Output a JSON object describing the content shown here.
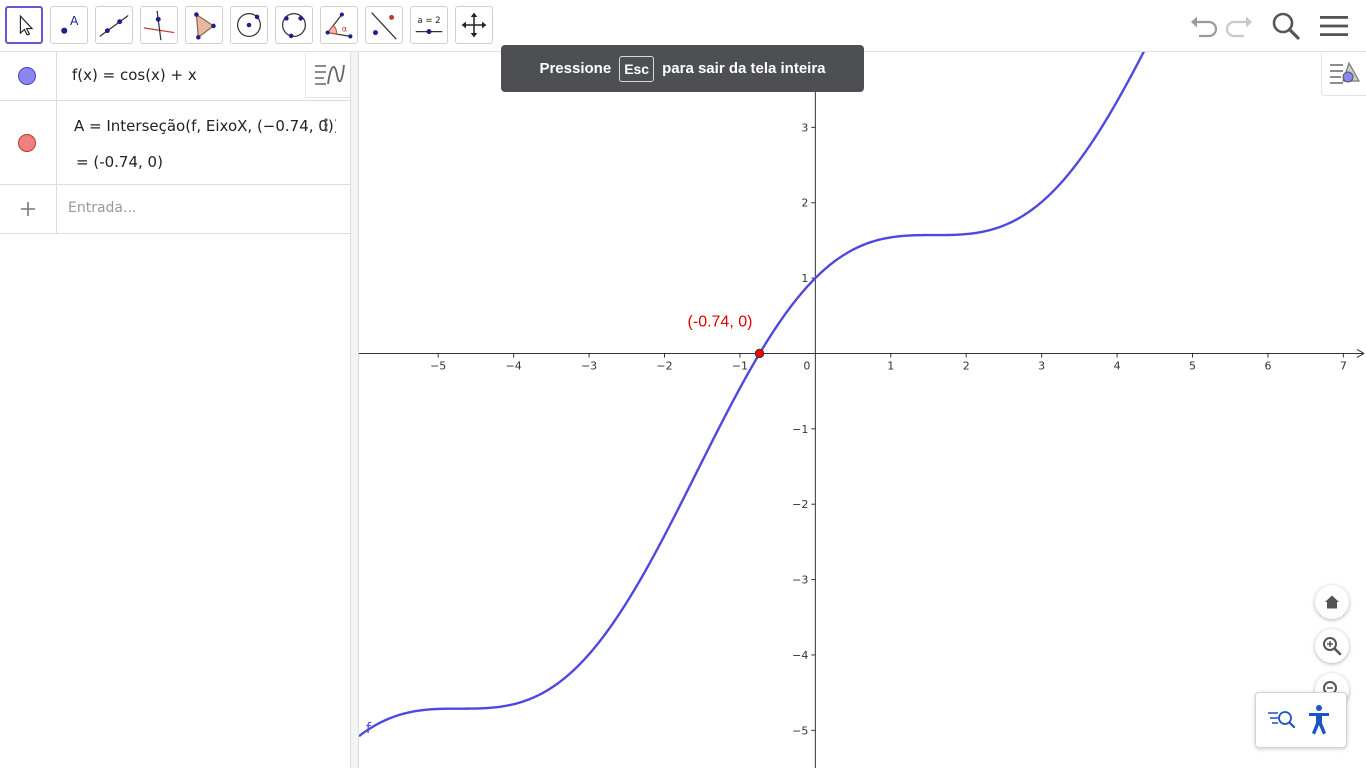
{
  "toolbar": {
    "tools": [
      {
        "name": "move-tool-icon",
        "active": true
      },
      {
        "name": "point-tool-icon",
        "label": "A"
      },
      {
        "name": "line-tool-icon"
      },
      {
        "name": "perpendicular-line-tool-icon"
      },
      {
        "name": "polygon-tool-icon"
      },
      {
        "name": "circle-tool-icon"
      },
      {
        "name": "circle-three-points-tool-icon"
      },
      {
        "name": "angle-tool-icon"
      },
      {
        "name": "reflect-tool-icon"
      },
      {
        "name": "slider-tool-icon",
        "label": "a = 2"
      },
      {
        "name": "move-graphics-view-tool-icon"
      }
    ],
    "right": [
      "undo-icon",
      "redo-icon",
      "search-icon",
      "menu-icon"
    ]
  },
  "toast": {
    "prefix": "Pressione",
    "key": "Esc",
    "suffix": "para sair da tela inteira"
  },
  "algebra": {
    "rows": [
      {
        "definition": "f(x)  =  cos(x) + x",
        "color": "#8b86f0"
      },
      {
        "definition": "A  =  Interseção(f, EixoX, (−0.74, 0))",
        "value": "=  (-0.74, 0)",
        "color": "#f08080"
      }
    ],
    "input_placeholder": "Entrada..."
  },
  "graph": {
    "function_label": "f",
    "point_label": "(-0.74, 0)",
    "point_color": "#ff0000",
    "curve_color": "#4f48e0",
    "x_ticks": [
      "−5",
      "−4",
      "−3",
      "−2",
      "−1",
      "0",
      "1",
      "2",
      "3",
      "4",
      "5",
      "6",
      "7"
    ],
    "y_ticks": [
      "3",
      "2",
      "1",
      "−1",
      "−2",
      "−3",
      "−4",
      "−5"
    ]
  },
  "chart_data": {
    "type": "line",
    "function": "cos(x) + x",
    "xlim": [
      -6.05,
      7.3
    ],
    "ylim": [
      -5.5,
      4.0
    ],
    "point": {
      "x": -0.74,
      "y": 0
    },
    "grid": false
  },
  "colors": {
    "accent": "#6557d2",
    "nav_blue": "#1a54c6"
  }
}
